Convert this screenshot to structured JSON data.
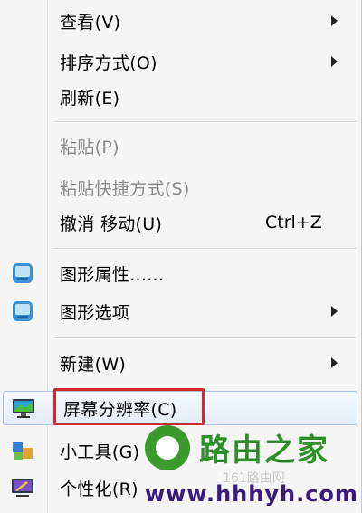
{
  "menu": {
    "items": [
      {
        "label": "查看(V)",
        "submenu": true
      },
      {
        "label": "排序方式(O)",
        "submenu": true
      },
      {
        "label": "刷新(E)"
      },
      {
        "label": "粘贴(P)",
        "disabled": true
      },
      {
        "label": "粘贴快捷方式(S)",
        "disabled": true
      },
      {
        "label": "撤消 移动(U)",
        "shortcut": "Ctrl+Z"
      },
      {
        "label": "图形属性......",
        "icon": "graphics-properties-icon"
      },
      {
        "label": "图形选项",
        "icon": "graphics-options-icon",
        "submenu": true
      },
      {
        "label": "新建(W)",
        "submenu": true
      },
      {
        "label": "屏幕分辨率(C)",
        "icon": "monitor-icon",
        "highlighted": true
      },
      {
        "label": "小工具(G)",
        "icon": "gadgets-icon"
      },
      {
        "label": "个性化(R)",
        "icon": "personalize-icon"
      }
    ]
  },
  "watermark": {
    "title": "路由之家",
    "subtitle": "161路由网",
    "url": "www.hhhyh.com"
  },
  "colors": {
    "highlight_border": "#d7262b",
    "hover_border": "#a9c3e6",
    "watermark_green": "#2e8f2a"
  }
}
